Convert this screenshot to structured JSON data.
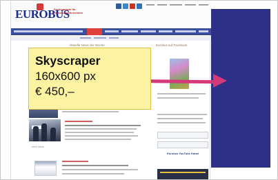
{
  "website": {
    "logo_text": "EUROBUS",
    "tagline": "Fachmagazin für Reisebusunternehmer",
    "section_heading": "Aktuelle News der Woche",
    "sidebar_heading": "Eurobus auf Facebook",
    "more_link": "mehr News",
    "youtube_label": "Eurobus YouTube Kanal",
    "social_icons": [
      "facebook-icon",
      "twitter-icon",
      "googleplus-icon",
      "linkedin-icon"
    ]
  },
  "ad_info": {
    "title": "Skyscraper",
    "dimensions": "160x600 px",
    "price": "€ 450,–"
  },
  "colors": {
    "skyscraper_slot": "#2e2f86",
    "arrow": "#d43a7a",
    "info_box_background": "#fcf3a2",
    "nav_bar": "#3b4f9e",
    "nav_active": "#e0403a"
  }
}
